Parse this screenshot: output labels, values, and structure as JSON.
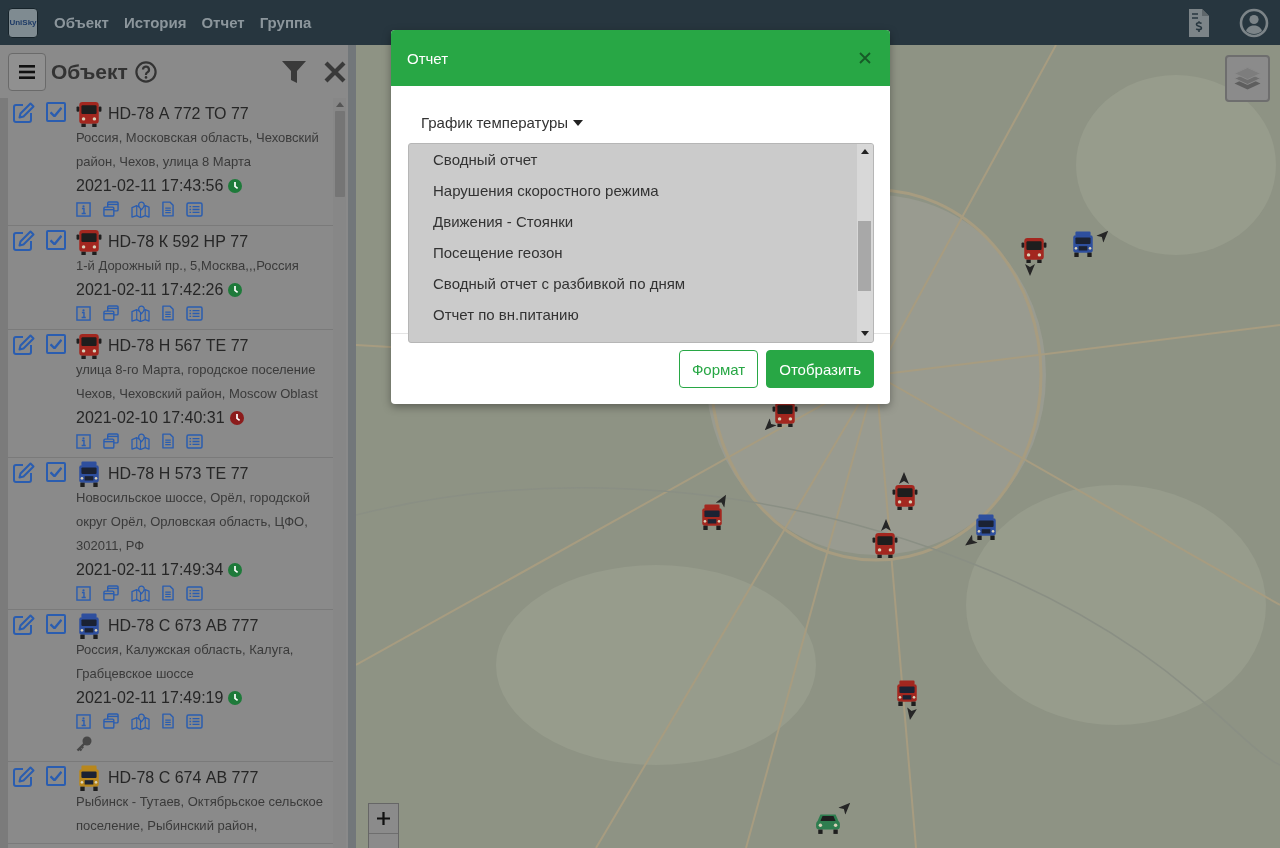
{
  "navbar": {
    "logo_text": "UniSky",
    "menu": [
      "Объект",
      "История",
      "Отчет",
      "Группа"
    ]
  },
  "sidebar": {
    "title": "Объект",
    "objects": [
      {
        "name": "HD-78 А 772 ТО 77",
        "checked": true,
        "vehicle": {
          "kind": "bus",
          "color": "#a3271f"
        },
        "address": "Россия, Московская область, Чеховский район, Чехов, улица 8 Марта",
        "time": "2021-02-11 17:43:56",
        "clock": {
          "color": "#1e7a3a"
        },
        "key": false
      },
      {
        "name": "HD-78 К 592 НР 77",
        "checked": true,
        "vehicle": {
          "kind": "bus",
          "color": "#a3271f"
        },
        "address": "1-й Дорожный пр., 5,Москва,,,Россия",
        "time": "2021-02-11 17:42:26",
        "clock": {
          "color": "#1e7a3a"
        },
        "key": false
      },
      {
        "name": "HD-78 Н 567 ТЕ 77",
        "checked": true,
        "vehicle": {
          "kind": "bus",
          "color": "#a3271f"
        },
        "address": "улица 8-го Марта, городское поселение Чехов, Чеховский район, Moscow Oblast",
        "time": "2021-02-10 17:40:31",
        "clock": {
          "color": "#8c1c1c"
        },
        "key": false
      },
      {
        "name": "HD-78 Н 573 ТЕ 77",
        "checked": true,
        "vehicle": {
          "kind": "truck",
          "color": "#2e4f9e"
        },
        "address": "Новосильское шоссе, Орёл, городской округ Орёл, Орловская область, ЦФО, 302011, РФ",
        "time": "2021-02-11 17:49:34",
        "clock": {
          "color": "#1e7a3a"
        },
        "key": false
      },
      {
        "name": "HD-78 С 673 АВ 777",
        "checked": true,
        "vehicle": {
          "kind": "truck",
          "color": "#2e4f9e"
        },
        "address": "Россия, Калужская область, Калуга, Грабцевское шоссе",
        "time": "2021-02-11 17:49:19",
        "clock": {
          "color": "#1e7a3a"
        },
        "key": true
      },
      {
        "name": "HD-78 С 674 АВ 777",
        "checked": true,
        "vehicle": {
          "kind": "truck",
          "color": "#b8871c"
        },
        "address": "Рыбинск - Тутаев, Октябрьское сельское поселение, Рыбинский район,",
        "key": false
      }
    ]
  },
  "map": {
    "markers": [
      {
        "kind": "bus",
        "color": "#a3271f"
      },
      {
        "kind": "truck",
        "color": "#2e4f9e"
      },
      {
        "kind": "bus",
        "color": "#a3271f"
      },
      {
        "kind": "truck",
        "color": "#a3271f"
      },
      {
        "kind": "bus",
        "color": "#a3271f"
      },
      {
        "kind": "bus",
        "color": "#a3271f"
      },
      {
        "kind": "truck",
        "color": "#2e4f9e"
      },
      {
        "kind": "truck",
        "color": "#a3271f"
      },
      {
        "kind": "car",
        "color": "#2e7d4f"
      }
    ]
  },
  "modal": {
    "title": "Отчет",
    "report_type": "График температуры",
    "options": [
      "Сводный отчет",
      "Нарушения скоростного режима",
      "Движения - Стоянки",
      "Посещение геозон",
      "Сводный отчет с разбивкой по дням",
      "Отчет по вн.питанию"
    ],
    "buttons": [
      {
        "label": "Формат",
        "kind": "outline"
      },
      {
        "label": "Отобразить",
        "kind": "primary"
      }
    ]
  }
}
